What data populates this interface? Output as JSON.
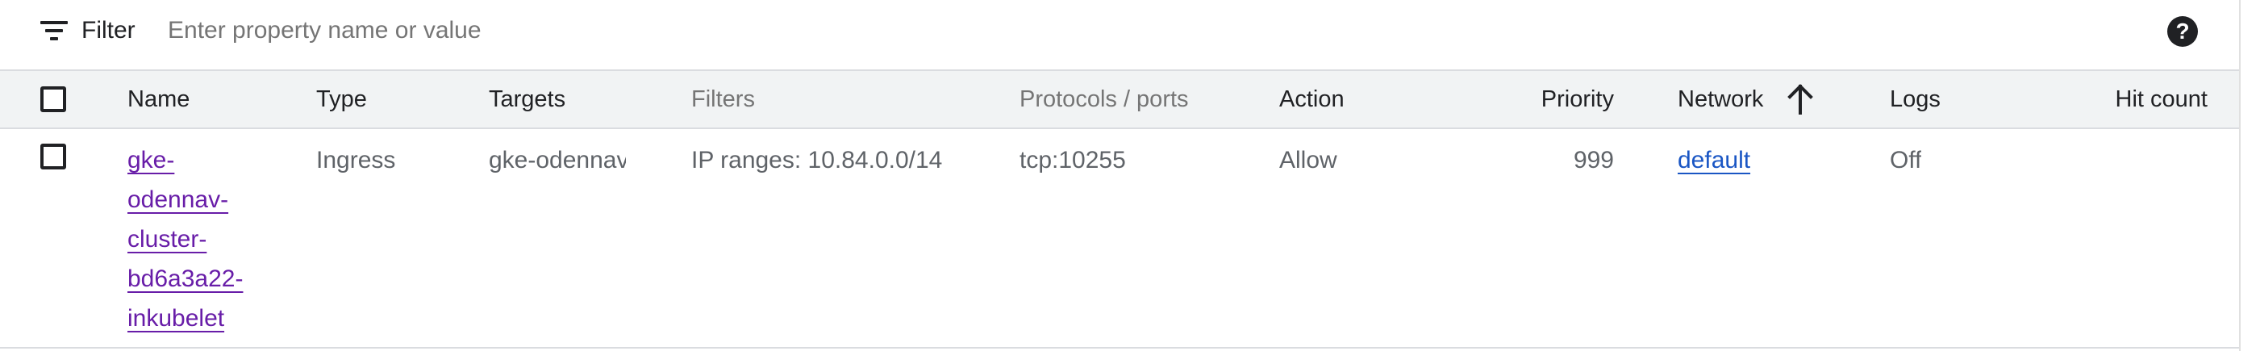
{
  "filter": {
    "label": "Filter",
    "placeholder": "Enter property name or value",
    "value": "",
    "icon": "filter-list-icon",
    "help_icon": "help-circle-icon",
    "help_glyph": "?"
  },
  "table": {
    "columns": {
      "name": "Name",
      "type": "Type",
      "targets": "Targets",
      "filters": "Filters",
      "protocols": "Protocols / ports",
      "action": "Action",
      "priority": "Priority",
      "network": "Network",
      "logs": "Logs",
      "hit_count": "Hit count"
    },
    "sort": {
      "column": "Network",
      "direction": "ascending",
      "icon": "arrow-up-icon"
    },
    "rows": [
      {
        "selected": false,
        "name_parts": [
          "gke-",
          "odennav-",
          "cluster-",
          "bd6a3a22-",
          "inkubelet"
        ],
        "type": "Ingress",
        "targets": "gke-odennav-cluster",
        "filters": "IP ranges: 10.84.0.0/14",
        "protocols": "tcp:10255",
        "action": "Allow",
        "priority": "999",
        "network": "default",
        "logs": "Off",
        "hit_count": ""
      }
    ]
  },
  "colors": {
    "link_visited": "#681da8",
    "link": "#1a56c4",
    "header_bg": "#f1f3f4",
    "muted_text": "#757575",
    "cell_text": "#5f6368"
  }
}
